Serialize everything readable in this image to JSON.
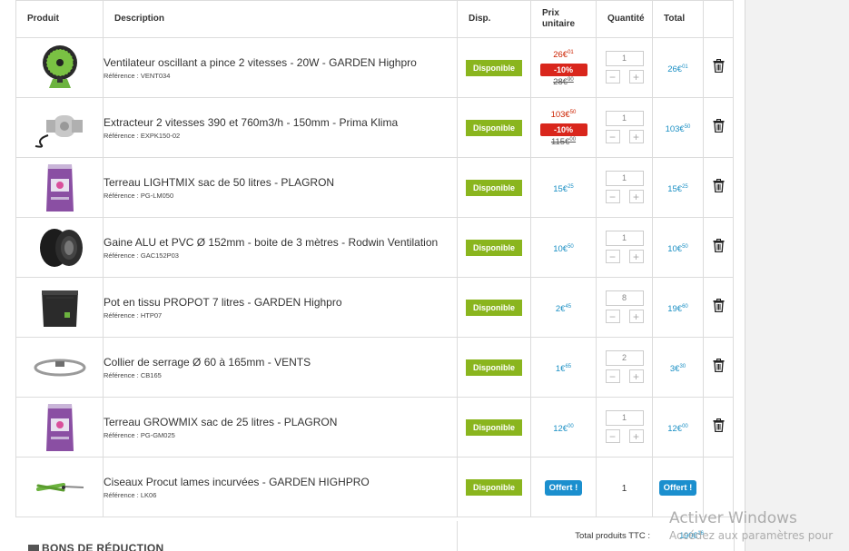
{
  "headers": {
    "produit": "Produit",
    "description": "Description",
    "disp": "Disp.",
    "prix_line1": "Prix",
    "prix_line2": "unitaire",
    "quantite": "Quantité",
    "total": "Total"
  },
  "availability_label": "Disponible",
  "free_label": "Offert !",
  "colors": {
    "available": "#8ab51e",
    "price": "#1a8fc4",
    "promo": "#d9261c",
    "offert": "#1b8fce"
  },
  "items": [
    {
      "name": "Ventilateur oscillant a pince 2 vitesses - 20W - GARDEN Highpro",
      "ref": "Référence : VENT034",
      "price_int": "26€",
      "price_dec": "01",
      "promo": true,
      "discount": "-10%",
      "old_int": "28€",
      "old_dec": "90",
      "qty": "1",
      "total_int": "26€",
      "total_dec": "01",
      "icon": "fan-icon"
    },
    {
      "name": "Extracteur 2 vitesses 390 et 760m3/h - 150mm - Prima Klima",
      "ref": "Référence : EXPK150-02",
      "price_int": "103€",
      "price_dec": "50",
      "promo": true,
      "discount": "-10%",
      "old_int": "115€",
      "old_dec": "00",
      "qty": "1",
      "total_int": "103€",
      "total_dec": "50",
      "icon": "extractor-fan-icon"
    },
    {
      "name": "Terreau LIGHTMIX sac de 50 litres - PLAGRON",
      "ref": "Référence : PG-LM050",
      "price_int": "15€",
      "price_dec": "25",
      "promo": false,
      "qty": "1",
      "total_int": "15€",
      "total_dec": "25",
      "icon": "soil-bag-icon"
    },
    {
      "name": "Gaine ALU et PVC Ø 152mm - boite de 3 mètres - Rodwin Ventilation",
      "ref": "Référence : GAC152P03",
      "price_int": "10€",
      "price_dec": "50",
      "promo": false,
      "qty": "1",
      "total_int": "10€",
      "total_dec": "50",
      "icon": "duct-icon"
    },
    {
      "name": "Pot en tissu PROPOT 7 litres - GARDEN Highpro",
      "ref": "Référence : HTP07",
      "price_int": "2€",
      "price_dec": "45",
      "promo": false,
      "qty": "8",
      "total_int": "19€",
      "total_dec": "60",
      "icon": "fabric-pot-icon"
    },
    {
      "name": "Collier de serrage Ø 60 à 165mm - VENTS",
      "ref": "Référence : CB165",
      "price_int": "1€",
      "price_dec": "65",
      "promo": false,
      "qty": "2",
      "total_int": "3€",
      "total_dec": "30",
      "icon": "hose-clamp-icon"
    },
    {
      "name": "Terreau GROWMIX sac de 25 litres - PLAGRON",
      "ref": "Référence : PG-GM025",
      "price_int": "12€",
      "price_dec": "00",
      "promo": false,
      "qty": "1",
      "total_int": "12€",
      "total_dec": "00",
      "icon": "soil-bag-icon"
    },
    {
      "name": "Ciseaux Procut lames incurvées - GARDEN HIGHPRO",
      "ref": "Référence : LK06",
      "free": true,
      "qty": "1",
      "icon": "scissors-icon"
    }
  ],
  "footer": {
    "total_label": "Total produits TTC :",
    "total_int": "190€",
    "total_dec": "16"
  },
  "vouchers_heading": "BONS DE RÉDUCTION",
  "watermark": {
    "line1": "Activer Windows",
    "line2": "Accédez aux paramètres pour"
  }
}
